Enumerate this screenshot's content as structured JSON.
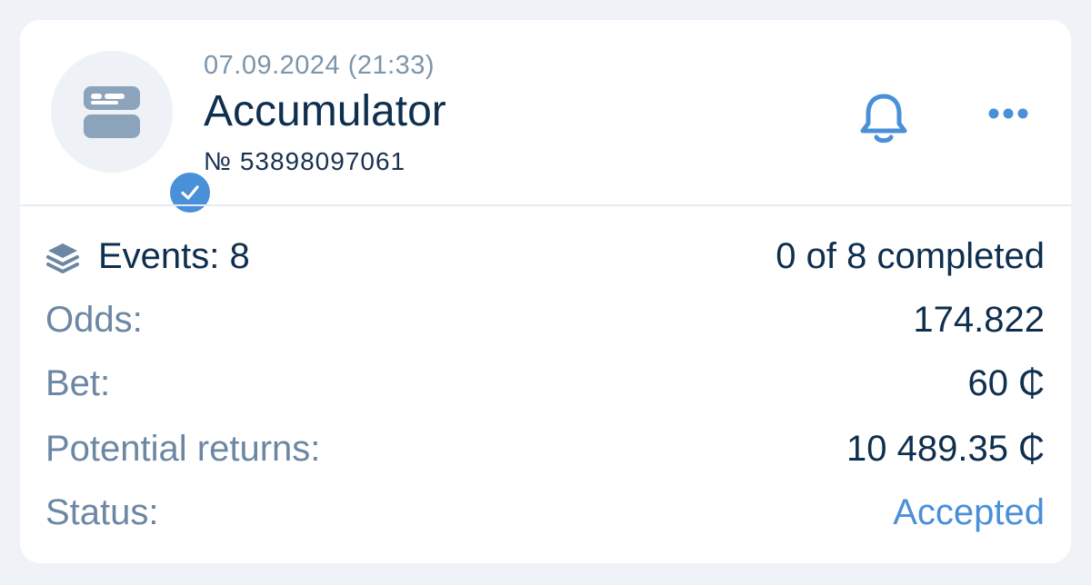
{
  "bet": {
    "datetime": "07.09.2024 (21:33)",
    "type": "Accumulator",
    "number": "№ 53898097061"
  },
  "actions": {
    "notify_icon": "bell-icon",
    "more_icon": "more-horizontal-icon"
  },
  "summary": {
    "events_label": "Events: 8",
    "events_progress": "0 of 8 completed",
    "odds_label": "Odds:",
    "odds_value": "174.822",
    "bet_label": "Bet:",
    "bet_value": "60 ₵",
    "returns_label": "Potential returns:",
    "returns_value": "10 489.35 ₵",
    "status_label": "Status:",
    "status_value": "Accepted"
  },
  "colors": {
    "accent": "#4a90d9",
    "primary_text": "#0f2f4f",
    "secondary_text": "#6c87a3",
    "background": "#eff2f7",
    "card": "#ffffff"
  }
}
